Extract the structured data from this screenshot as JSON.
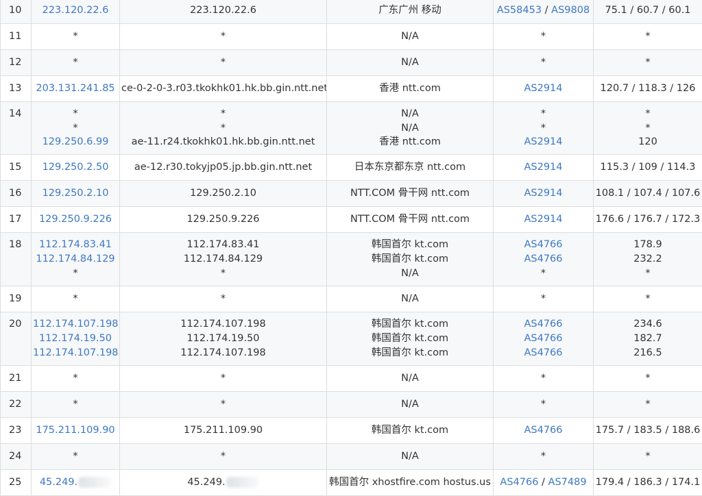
{
  "rows": [
    {
      "hop": "10",
      "ip": [
        "223.120.22.6"
      ],
      "host": [
        "223.120.22.6"
      ],
      "loc": [
        "广东广州 移动"
      ],
      "as": [
        [
          "AS58453",
          "AS9808"
        ]
      ],
      "time": [
        "75.1 / 60.7 / 60.1"
      ]
    },
    {
      "hop": "11",
      "ip": [
        "*"
      ],
      "host": [
        "*"
      ],
      "loc": [
        "N/A"
      ],
      "as": [
        [
          "*"
        ]
      ],
      "time": [
        "*"
      ]
    },
    {
      "hop": "12",
      "ip": [
        "*"
      ],
      "host": [
        "*"
      ],
      "loc": [
        "N/A"
      ],
      "as": [
        [
          "*"
        ]
      ],
      "time": [
        "*"
      ]
    },
    {
      "hop": "13",
      "ip": [
        "203.131.241.85"
      ],
      "host": [
        "ce-0-2-0-3.r03.tkokhk01.hk.bb.gin.ntt.net"
      ],
      "loc": [
        "香港 ntt.com"
      ],
      "as": [
        [
          "AS2914"
        ]
      ],
      "time": [
        "120.7 / 118.3 / 126"
      ]
    },
    {
      "hop": "14",
      "ip": [
        "*",
        "*",
        "129.250.6.99"
      ],
      "host": [
        "*",
        "*",
        "ae-11.r24.tkokhk01.hk.bb.gin.ntt.net"
      ],
      "loc": [
        "N/A",
        "N/A",
        "香港 ntt.com"
      ],
      "as": [
        [
          "*"
        ],
        [
          "*"
        ],
        [
          "AS2914"
        ]
      ],
      "time": [
        "*",
        "*",
        "120"
      ]
    },
    {
      "hop": "15",
      "ip": [
        "129.250.2.50"
      ],
      "host": [
        "ae-12.r30.tokyjp05.jp.bb.gin.ntt.net"
      ],
      "loc": [
        "日本东京都东京 ntt.com"
      ],
      "as": [
        [
          "AS2914"
        ]
      ],
      "time": [
        "115.3 / 109 / 114.3"
      ]
    },
    {
      "hop": "16",
      "ip": [
        "129.250.2.10"
      ],
      "host": [
        "129.250.2.10"
      ],
      "loc": [
        "NTT.COM 骨干网 ntt.com"
      ],
      "as": [
        [
          "AS2914"
        ]
      ],
      "time": [
        "108.1 / 107.4 / 107.6"
      ]
    },
    {
      "hop": "17",
      "ip": [
        "129.250.9.226"
      ],
      "host": [
        "129.250.9.226"
      ],
      "loc": [
        "NTT.COM 骨干网 ntt.com"
      ],
      "as": [
        [
          "AS2914"
        ]
      ],
      "time": [
        "176.6 / 176.7 / 172.3"
      ]
    },
    {
      "hop": "18",
      "ip": [
        "112.174.83.41",
        "112.174.84.129",
        "*"
      ],
      "host": [
        "112.174.83.41",
        "112.174.84.129",
        "*"
      ],
      "loc": [
        "韩国首尔 kt.com",
        "韩国首尔 kt.com",
        "N/A"
      ],
      "as": [
        [
          "AS4766"
        ],
        [
          "AS4766"
        ],
        [
          "*"
        ]
      ],
      "time": [
        "178.9",
        "232.2",
        "*"
      ]
    },
    {
      "hop": "19",
      "ip": [
        "*"
      ],
      "host": [
        "*"
      ],
      "loc": [
        "N/A"
      ],
      "as": [
        [
          "*"
        ]
      ],
      "time": [
        "*"
      ]
    },
    {
      "hop": "20",
      "ip": [
        "112.174.107.198",
        "112.174.19.50",
        "112.174.107.198"
      ],
      "host": [
        "112.174.107.198",
        "112.174.19.50",
        "112.174.107.198"
      ],
      "loc": [
        "韩国首尔 kt.com",
        "韩国首尔 kt.com",
        "韩国首尔 kt.com"
      ],
      "as": [
        [
          "AS4766"
        ],
        [
          "AS4766"
        ],
        [
          "AS4766"
        ]
      ],
      "time": [
        "234.6",
        "182.7",
        "216.5"
      ]
    },
    {
      "hop": "21",
      "ip": [
        "*"
      ],
      "host": [
        "*"
      ],
      "loc": [
        "N/A"
      ],
      "as": [
        [
          "*"
        ]
      ],
      "time": [
        "*"
      ]
    },
    {
      "hop": "22",
      "ip": [
        "*"
      ],
      "host": [
        "*"
      ],
      "loc": [
        "N/A"
      ],
      "as": [
        [
          "*"
        ]
      ],
      "time": [
        "*"
      ]
    },
    {
      "hop": "23",
      "ip": [
        "175.211.109.90"
      ],
      "host": [
        "175.211.109.90"
      ],
      "loc": [
        "韩国首尔 kt.com"
      ],
      "as": [
        [
          "AS4766"
        ]
      ],
      "time": [
        "175.7 / 183.5 / 188.6"
      ]
    },
    {
      "hop": "24",
      "ip": [
        "*"
      ],
      "host": [
        "*"
      ],
      "loc": [
        "N/A"
      ],
      "as": [
        [
          "*"
        ]
      ],
      "time": [
        "*"
      ]
    },
    {
      "hop": "25",
      "ip": [
        "45.249."
      ],
      "host": [
        "45.249."
      ],
      "loc": [
        "韩国首尔 xhostfire.com hostus.us"
      ],
      "as": [
        [
          "AS4766",
          "AS7489"
        ]
      ],
      "time": [
        "179.4 / 186.3 / 174.1"
      ],
      "masked": true
    }
  ]
}
